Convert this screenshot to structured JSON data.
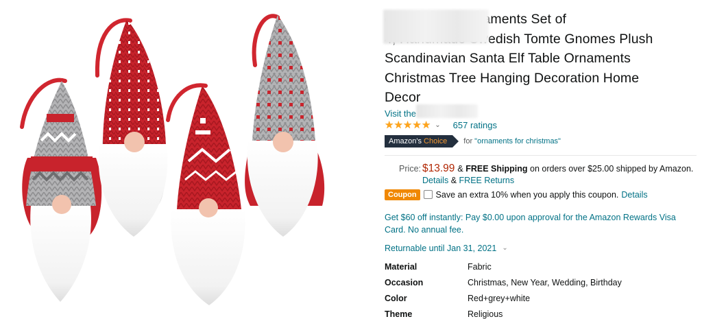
{
  "product": {
    "title": "e Christmas Ornaments Set of 4, Handmade Swedish Tomte Gnomes Plush Scandinavian Santa Elf Table Ornaments Christmas Tree Hanging Decoration Home Decor",
    "title_lines": [
      "e Christmas Ornaments Set of",
      "4, Handmade Swedish Tomte Gnomes Plush",
      "Scandinavian Santa Elf Table Ornaments",
      "Christmas Tree Hanging Decoration Home",
      "Decor"
    ],
    "store_link": "Visit the",
    "rating": 4.5,
    "rating_max": 5,
    "ratings_count": "657 ratings",
    "image_alt": "Set of 4 knitted Christmas gnome ornaments with red and grey hats and white beards"
  },
  "badge": {
    "label_prefix": "Amazon's",
    "label_suffix": "Choice",
    "for_text": "for",
    "keyword": "\"ornaments for christmas\""
  },
  "price": {
    "label": "Price:",
    "value": "$13.99",
    "shipping_prefix": "&",
    "shipping_bold": "FREE Shipping",
    "shipping_suffix": "on orders over $25.00 shipped by Amazon.",
    "details_link": "Details",
    "amp": "&",
    "returns_link": "FREE Returns"
  },
  "coupon": {
    "badge": "Coupon",
    "text": "Save an extra 10% when you apply this coupon.",
    "details_link": "Details"
  },
  "rewards": {
    "text": "Get $60 off instantly: Pay $0.00 upon approval for the Amazon Rewards Visa Card. No annual fee."
  },
  "returnable": {
    "text": "Returnable until Jan 31, 2021"
  },
  "specs": [
    {
      "key": "Material",
      "value": "Fabric"
    },
    {
      "key": "Occasion",
      "value": "Christmas, New Year, Wedding, Birthday"
    },
    {
      "key": "Color",
      "value": "Red+grey+white"
    },
    {
      "key": "Theme",
      "value": "Religious"
    }
  ],
  "colors": {
    "link": "#007185",
    "price": "#B12704",
    "star": "#FFA41C",
    "badge_dark": "#232F3E",
    "coupon": "#F08804",
    "gnome_red": "#C8232C",
    "gnome_grey": "#A9A9AB"
  }
}
